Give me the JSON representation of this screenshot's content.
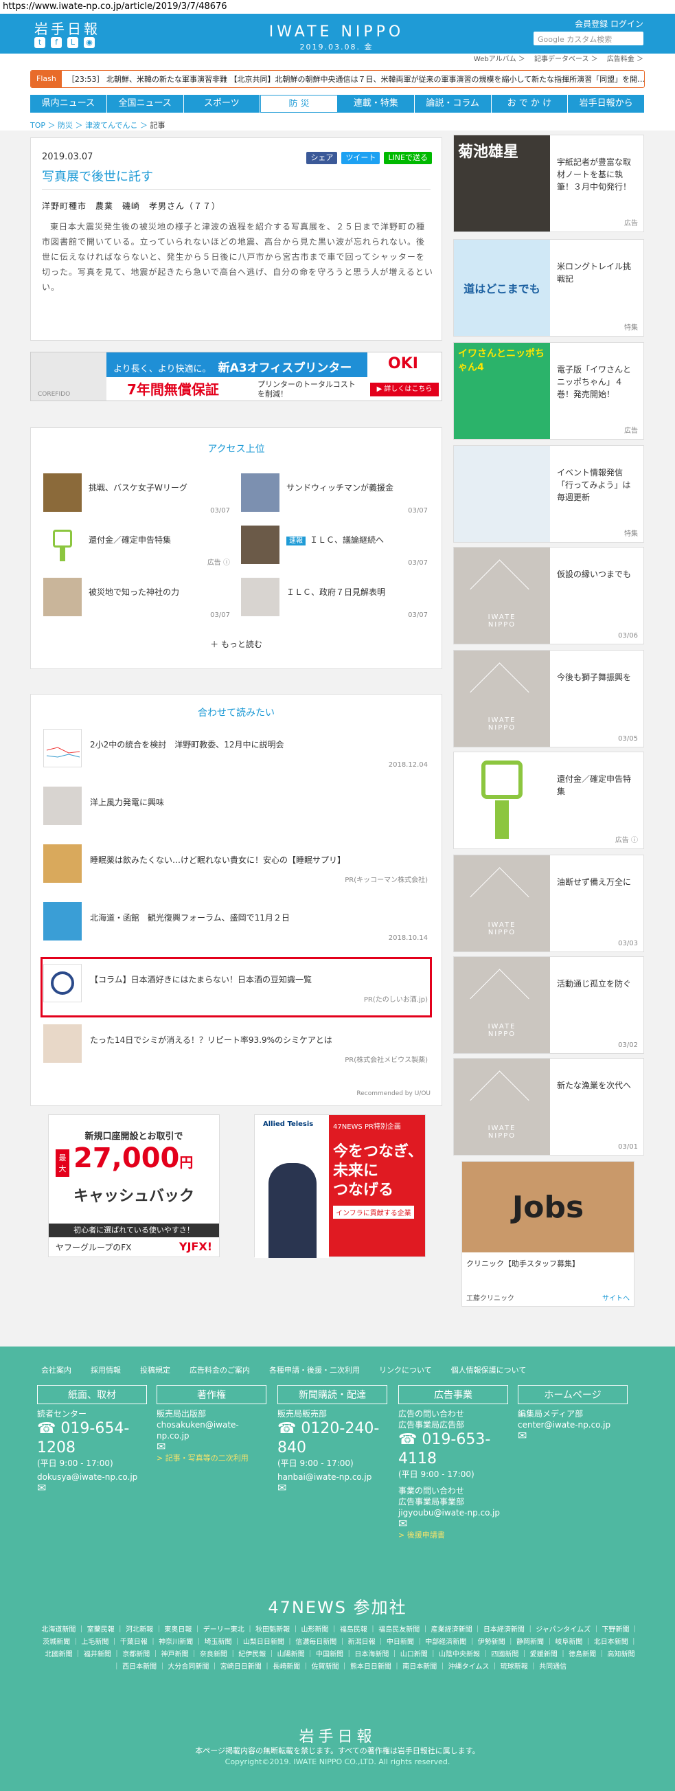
{
  "url": "https://www.iwate-np.co.jp/article/2019/3/7/48676",
  "header": {
    "logo_jp": "岩手日報",
    "logo_en": "IWATE NIPPO",
    "date": "2019.03.08. 金",
    "links": "会員登録 ログイン",
    "search_placeholder": "Google カスタム検索"
  },
  "subnav": "Webアルバム ＞ 　記事データベース ＞ 　広告料金 ＞",
  "flash": {
    "tag": "Flash",
    "text": "［23:53］ 北朝鮮、米韓の新たな軍事演習非難 【北京共同】北朝鮮の朝鮮中央通信は７日、米韓両軍が従来の軍事演習の規模を縮小して新たな指揮所演習「同盟」を開…"
  },
  "nav": [
    "県内ニュース",
    "全国ニュース",
    "スポーツ",
    "防 災",
    "連載・特集",
    "論説・コラム",
    "お で か け",
    "岩手日報から"
  ],
  "breadcrumb": {
    "a": "TOP",
    "b": "防災",
    "c": "津波てんでんこ",
    "cur": "記事"
  },
  "article": {
    "date": "2019.03.07",
    "title": "写真展で後世に託す",
    "share": [
      "シェア",
      "ツイート",
      "LINEで送る"
    ],
    "sub": "洋野町種市　農業　磯崎　孝男さん（７７）",
    "body": "東日本大震災発生後の被災地の様子と津波の過程を紹介する写真展を、２５日まで洋野町の種市図書館で開いている。立っていられないほどの地震、高台から見た黒い波が忘れられない。後世に伝えなければならないと、発生から５日後に八戸市から宮古市まで車で回ってシャッターを切った。写真を見て、地震が起きたら急いで高台へ逃げ、自分の命を守ろうと思う人が増えるといい。"
  },
  "ad_banner": {
    "l1": "より長く、より快適に。",
    "l2": "新A3オフィスプリンター誕生。",
    "l3": "7年間無償保証",
    "l4": "プリンターのトータルコストを削減！",
    "brand": "OKI",
    "cta": "▶ 詳しくはこちら",
    "model": "COREFIDO"
  },
  "access": {
    "title": "アクセス上位",
    "items": [
      {
        "t": "挑戦、バスケ女子Wリーグ",
        "d": "03/07"
      },
      {
        "t": "サンドウィッチマンが義援金",
        "d": "03/07"
      },
      {
        "t": "還付金／確定申告特集",
        "d": "広告 ⓘ"
      },
      {
        "t": "ＩＬＣ、議論継続へ",
        "d": "03/07",
        "badge": "速報"
      },
      {
        "t": "被災地で知った神社の力",
        "d": "03/07"
      },
      {
        "t": "ＩＬＣ、政府７日見解表明",
        "d": "03/07"
      }
    ],
    "more": "もっと読む"
  },
  "related": {
    "title": "合わせて読みたい",
    "items": [
      {
        "t": "2小2中の統合を検討　洋野町教委、12月中に説明会",
        "d": "2018.12.04"
      },
      {
        "t": "洋上風力発電に興味",
        "d": ""
      },
      {
        "t": "睡眠薬は飲みたくない…けど眠れない貴女に！安心の【睡眠サプリ】",
        "d": "PR(キッコーマン株式会社)"
      },
      {
        "t": "北海道・函館　観光復興フォーラム、盛岡で11月２日",
        "d": "2018.10.14"
      },
      {
        "t": "【コラム】日本酒好きにはたまらない！日本酒の豆知識一覧",
        "d": "PR(たのしいお酒.jp)"
      },
      {
        "t": "たった14日でシミが消える！？リピート率93.9%のシミケアとは",
        "d": "PR(株式会社メビウス製薬)"
      }
    ],
    "rec": "Recommended by U/OU"
  },
  "bottom_ads": {
    "a1": "新規口座開設とお取引で",
    "a2": "最大",
    "a3": "27,000",
    "a4": "円",
    "a5": "キャッシュバック",
    "a6": "初心者に選ばれている使いやすさ！",
    "a7": "ヤフーグループのFX",
    "a8": "YJFX!",
    "b0": "47NEWS PR特別企画",
    "b1": "今をつなぎ、",
    "b2": "未来に",
    "b3": "つなげる",
    "b4": "インフラに貢献する企業",
    "b5": "Allied Telesis",
    "c1": "Jobs",
    "c2": "クリニック【助手スタッフ募集】",
    "c3": "工藤クリニック",
    "c4": "サイトへ"
  },
  "sidebar": [
    {
      "t": "宇紙記者が豊富な取材ノートを基に執筆！３月中旬発行！",
      "d": "広告",
      "img": "菊池雄星"
    },
    {
      "t": "米ロングトレイル挑戦記",
      "d": "特集",
      "img": "道はどこまでも"
    },
    {
      "t": "電子版「イワさんとニッポちゃん」４巻！発売開始！",
      "d": "広告",
      "img": "イワさんとニッポちゃん4"
    },
    {
      "t": "イベント情報発信「行ってみよう」は毎週更新",
      "d": "特集"
    },
    {
      "t": "仮設の縁いつまでも",
      "d": "03/06"
    },
    {
      "t": "今後も獅子舞振興を",
      "d": "03/05"
    },
    {
      "t": "還付金／確定申告特集",
      "d": "広告 ⓘ"
    },
    {
      "t": "油断せず備え万全に",
      "d": "03/03"
    },
    {
      "t": "活動通じ孤立を防ぐ",
      "d": "03/02"
    },
    {
      "t": "新たな漁業を次代へ",
      "d": "03/01"
    }
  ],
  "footer": {
    "links": [
      "会社案内",
      "採用情報",
      "投稿規定",
      "広告料金のご案内",
      "各種申請・後援・二次利用",
      "リンクについて",
      "個人情報保護について"
    ],
    "cols": [
      {
        "box": "紙面、取材",
        "l1": "読者センター",
        "tel": "019-654-1208",
        "hrs": "(平日 9:00 - 17:00)",
        "mail": "dokusya@iwate-np.co.jp"
      },
      {
        "box": "著作権",
        "l1": "販売局出版部",
        "mail": "chosakuken@iwate-np.co.jp",
        "y": "> 記事・写真等の二次利用"
      },
      {
        "box": "新聞購読・配達",
        "l1": "販売局販売部",
        "tel": "0120-240-840",
        "hrs": "(平日 9:00 - 17:00)",
        "mail": "hanbai@iwate-np.co.jp"
      },
      {
        "box": "広告事業",
        "l1": "広告の問い合わせ",
        "l2": "広告事業局広告部",
        "tel": "019-653-4118",
        "hrs": "(平日 9:00 - 17:00)",
        "l3": "事業の問い合わせ",
        "l4": "広告事業局事業部",
        "mail": "jigyoubu@iwate-np.co.jp",
        "y": "> 後援申請書"
      },
      {
        "box": "ホームページ",
        "l1": "編集局メディア部",
        "mail": "center@iwate-np.co.jp"
      }
    ],
    "n47": "47NEWS 参加社",
    "papers": "北海道新聞 ｜ 室蘭民報 ｜ 河北新報 ｜ 東奥日報 ｜ デーリー東北 ｜ 秋田魁新報 ｜ 山形新聞 ｜ 福島民報 ｜ 福島民友新聞 ｜ 産業経済新聞 ｜ 日本経済新聞 ｜ ジャパンタイムズ ｜ 下野新聞 ｜ 茨城新聞 ｜ 上毛新聞 ｜ 千葉日報 ｜ 神奈川新聞 ｜ 埼玉新聞 ｜ 山梨日日新聞 ｜ 信濃毎日新聞 ｜ 新潟日報 ｜ 中日新聞 ｜ 中部経済新聞 ｜ 伊勢新聞 ｜ 静岡新聞 ｜ 岐阜新聞 ｜ 北日本新聞 ｜ 北國新聞 ｜ 福井新聞 ｜ 京都新聞 ｜ 神戸新聞 ｜ 奈良新聞 ｜ 紀伊民報 ｜ 山陽新聞 ｜ 中国新聞 ｜ 日本海新聞 ｜ 山口新聞 ｜ 山陰中央新報 ｜ 四國新聞 ｜ 愛媛新聞 ｜ 徳島新聞 ｜ 高知新聞 ｜ 西日本新聞 ｜ 大分合同新聞 ｜ 宮崎日日新聞 ｜ 長崎新聞 ｜ 佐賀新聞 ｜ 熊本日日新聞 ｜ 南日本新聞 ｜ 沖縄タイムス ｜ 琉球新報 ｜ 共同通信",
    "logo": "岩手日報",
    "note": "本ページ掲載内容の無断転載を禁じます。すべての著作権は岩手日報社に属します。",
    "copy": "Copyright©2019. IWATE NIPPO CO.,LTD. All rights reserved."
  }
}
